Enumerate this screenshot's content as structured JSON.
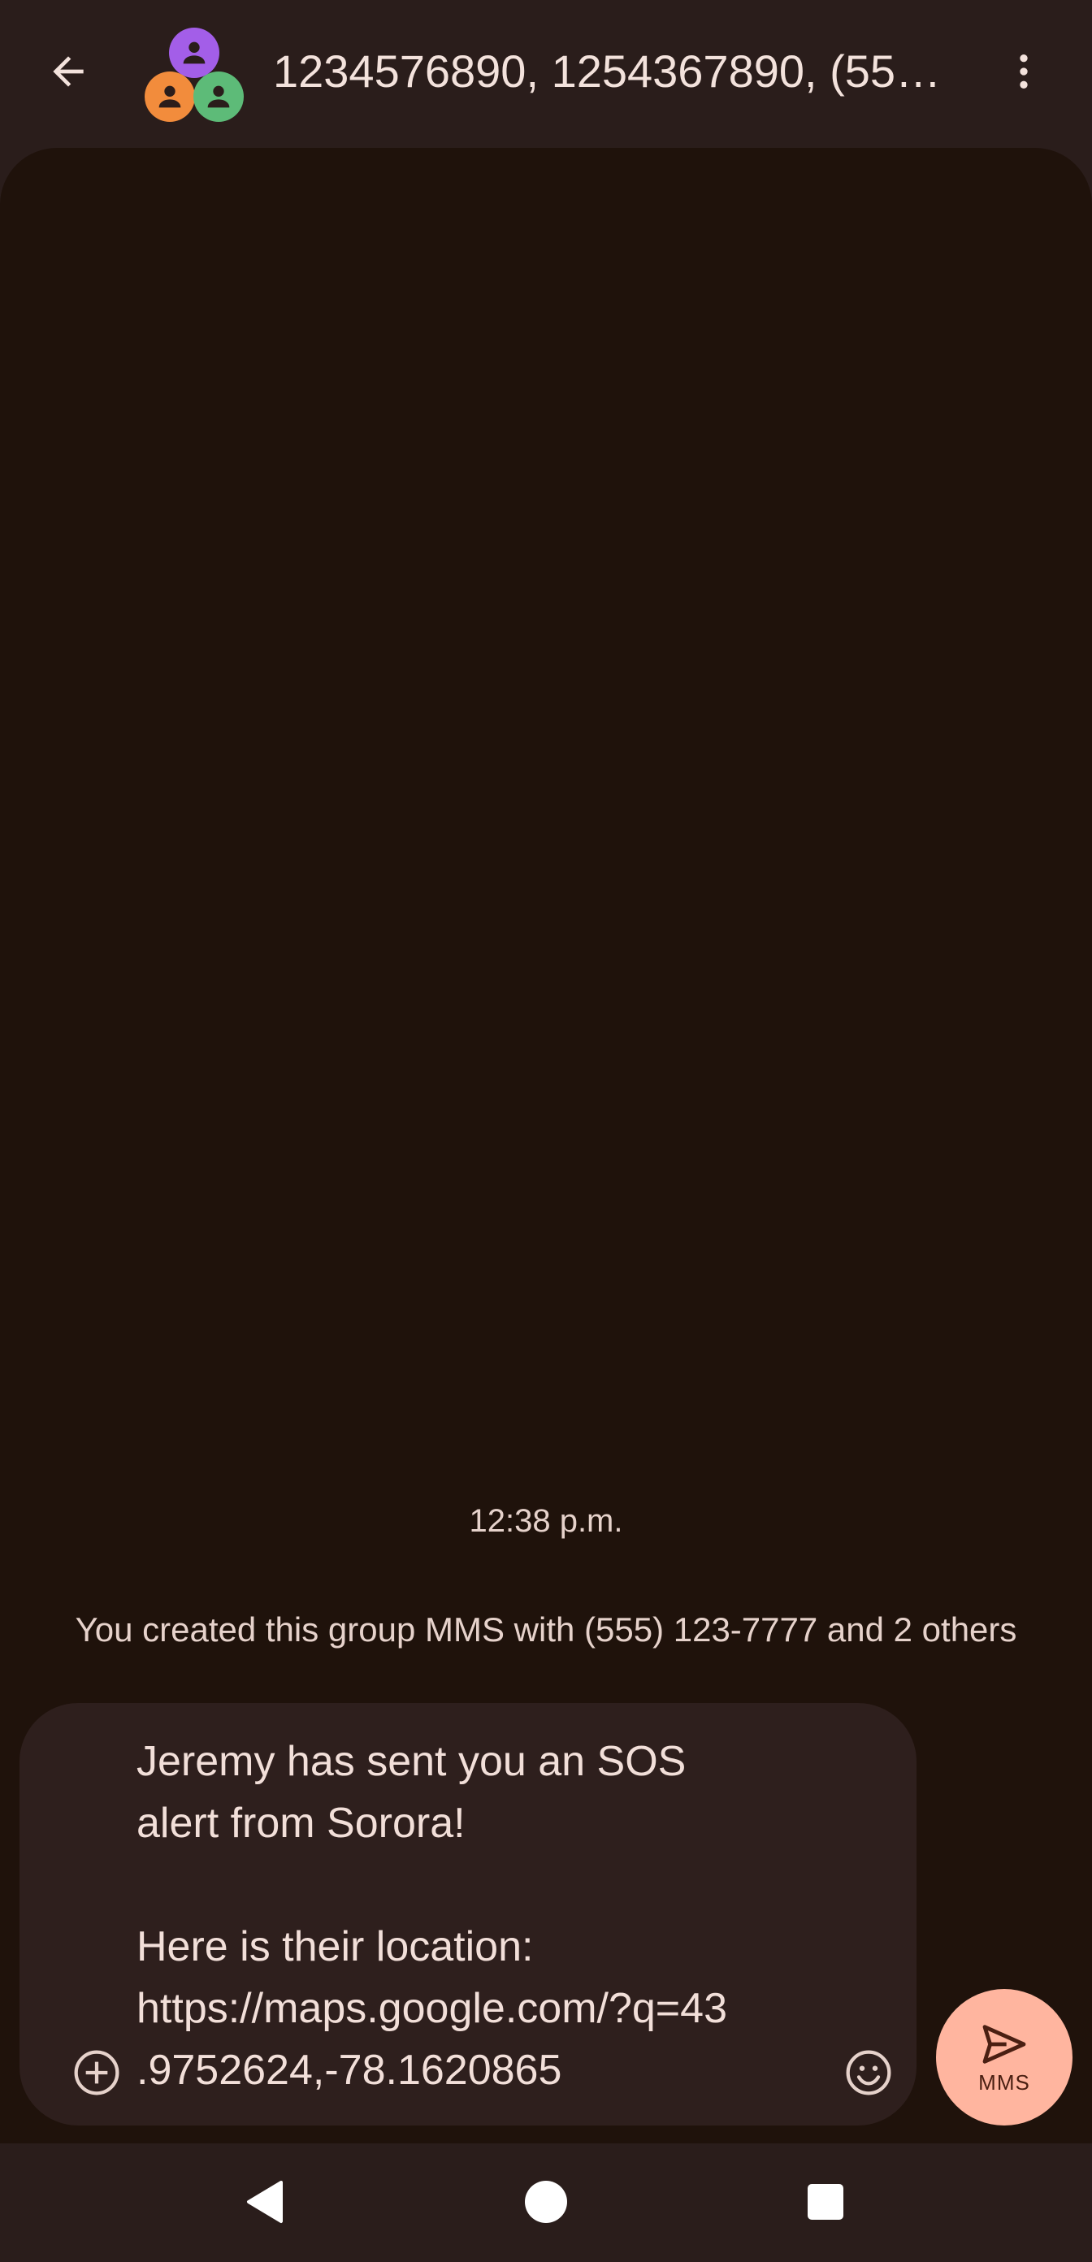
{
  "header": {
    "title": "1234576890, 1254367890, (55…",
    "back_icon": "arrow-back-icon",
    "more_icon": "more-vert-icon",
    "avatar_colors": [
      "#a35ee8",
      "#f28c3c",
      "#5dbb78"
    ]
  },
  "thread": {
    "timestamp": "12:38 p.m.",
    "group_info": "You created this group MMS with (555) 123-7777 and 2 others"
  },
  "composer": {
    "draft": "Jeremy has sent you an SOS\nalert from Sorora!\n\nHere is their location:\nhttps://maps.google.com/?q=43\n.9752624,-78.1620865",
    "attach_icon": "add-circle-icon",
    "emoji_icon": "emoji-icon",
    "send_label": "MMS",
    "send_color": "#ffb59f"
  },
  "navbar": {
    "back_icon": "nav-back-icon",
    "home_icon": "nav-home-icon",
    "recents_icon": "nav-recents-icon"
  }
}
